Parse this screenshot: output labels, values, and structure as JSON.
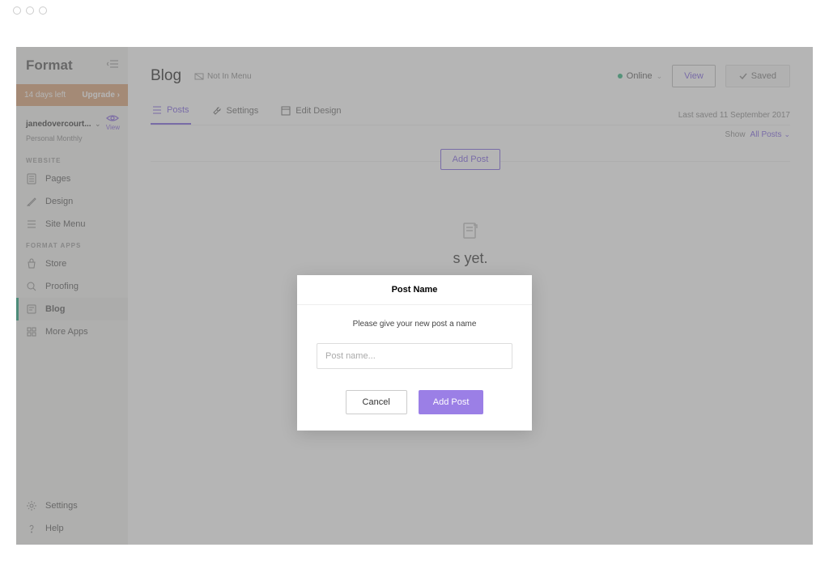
{
  "brand": "Format",
  "trial": {
    "days_left": "14 days left",
    "upgrade": "Upgrade"
  },
  "account": {
    "name": "janedovercourt...",
    "plan": "Personal Monthly",
    "view_label": "View"
  },
  "sidebar": {
    "section_website": "WEBSITE",
    "pages": "Pages",
    "design": "Design",
    "site_menu": "Site Menu",
    "section_apps": "FORMAT  APPS",
    "store": "Store",
    "proofing": "Proofing",
    "blog": "Blog",
    "more_apps": "More Apps",
    "settings": "Settings",
    "help": "Help"
  },
  "header": {
    "title": "Blog",
    "not_in_menu": "Not In Menu",
    "online": "Online",
    "view_btn": "View",
    "saved_btn": "Saved"
  },
  "tabs": {
    "posts": "Posts",
    "settings": "Settings",
    "edit_design": "Edit Design"
  },
  "last_saved": "Last saved 11 September 2017",
  "filter": {
    "show": "Show",
    "all_posts": "All Posts"
  },
  "add_post_btn": "Add Post",
  "empty_text": "s yet.",
  "modal": {
    "title": "Post Name",
    "instruction": "Please give your new post a name",
    "placeholder": "Post name...",
    "cancel": "Cancel",
    "submit": "Add Post"
  }
}
